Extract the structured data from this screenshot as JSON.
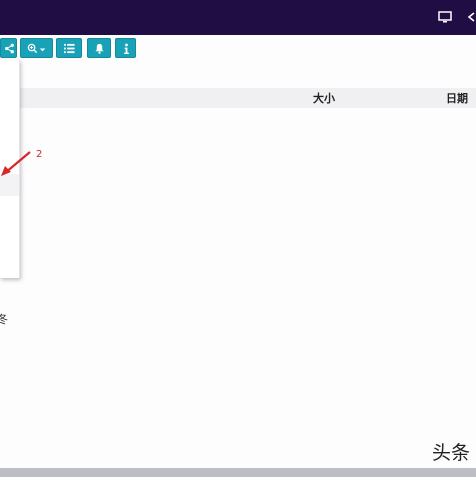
{
  "toolbar": {
    "buttons": [
      {
        "icon": "share-icon"
      },
      {
        "icon": "zoom-dropdown-icon"
      },
      {
        "icon": "list-view-icon"
      },
      {
        "icon": "bell-icon"
      },
      {
        "icon": "info-icon"
      }
    ]
  },
  "file_list": {
    "columns": {
      "size": "大小",
      "date": "日期"
    }
  },
  "context_menu": {
    "partial_item": "冬"
  },
  "annotation": {
    "number": "2",
    "color": "#d8262c"
  },
  "watermark": {
    "text": "头条"
  },
  "colors": {
    "topbar": "#1f0d44",
    "toolbar_button": "#19a2b7"
  }
}
